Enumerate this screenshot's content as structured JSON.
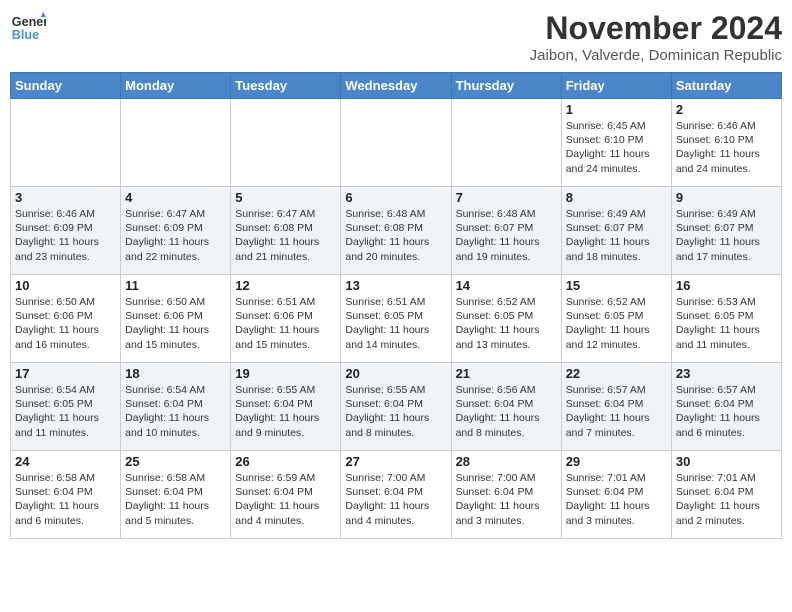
{
  "header": {
    "logo_line1": "General",
    "logo_line2": "Blue",
    "month": "November 2024",
    "location": "Jaibon, Valverde, Dominican Republic"
  },
  "weekdays": [
    "Sunday",
    "Monday",
    "Tuesday",
    "Wednesday",
    "Thursday",
    "Friday",
    "Saturday"
  ],
  "weeks": [
    [
      {
        "day": "",
        "info": ""
      },
      {
        "day": "",
        "info": ""
      },
      {
        "day": "",
        "info": ""
      },
      {
        "day": "",
        "info": ""
      },
      {
        "day": "",
        "info": ""
      },
      {
        "day": "1",
        "info": "Sunrise: 6:45 AM\nSunset: 6:10 PM\nDaylight: 11 hours and 24 minutes."
      },
      {
        "day": "2",
        "info": "Sunrise: 6:46 AM\nSunset: 6:10 PM\nDaylight: 11 hours and 24 minutes."
      }
    ],
    [
      {
        "day": "3",
        "info": "Sunrise: 6:46 AM\nSunset: 6:09 PM\nDaylight: 11 hours and 23 minutes."
      },
      {
        "day": "4",
        "info": "Sunrise: 6:47 AM\nSunset: 6:09 PM\nDaylight: 11 hours and 22 minutes."
      },
      {
        "day": "5",
        "info": "Sunrise: 6:47 AM\nSunset: 6:08 PM\nDaylight: 11 hours and 21 minutes."
      },
      {
        "day": "6",
        "info": "Sunrise: 6:48 AM\nSunset: 6:08 PM\nDaylight: 11 hours and 20 minutes."
      },
      {
        "day": "7",
        "info": "Sunrise: 6:48 AM\nSunset: 6:07 PM\nDaylight: 11 hours and 19 minutes."
      },
      {
        "day": "8",
        "info": "Sunrise: 6:49 AM\nSunset: 6:07 PM\nDaylight: 11 hours and 18 minutes."
      },
      {
        "day": "9",
        "info": "Sunrise: 6:49 AM\nSunset: 6:07 PM\nDaylight: 11 hours and 17 minutes."
      }
    ],
    [
      {
        "day": "10",
        "info": "Sunrise: 6:50 AM\nSunset: 6:06 PM\nDaylight: 11 hours and 16 minutes."
      },
      {
        "day": "11",
        "info": "Sunrise: 6:50 AM\nSunset: 6:06 PM\nDaylight: 11 hours and 15 minutes."
      },
      {
        "day": "12",
        "info": "Sunrise: 6:51 AM\nSunset: 6:06 PM\nDaylight: 11 hours and 15 minutes."
      },
      {
        "day": "13",
        "info": "Sunrise: 6:51 AM\nSunset: 6:05 PM\nDaylight: 11 hours and 14 minutes."
      },
      {
        "day": "14",
        "info": "Sunrise: 6:52 AM\nSunset: 6:05 PM\nDaylight: 11 hours and 13 minutes."
      },
      {
        "day": "15",
        "info": "Sunrise: 6:52 AM\nSunset: 6:05 PM\nDaylight: 11 hours and 12 minutes."
      },
      {
        "day": "16",
        "info": "Sunrise: 6:53 AM\nSunset: 6:05 PM\nDaylight: 11 hours and 11 minutes."
      }
    ],
    [
      {
        "day": "17",
        "info": "Sunrise: 6:54 AM\nSunset: 6:05 PM\nDaylight: 11 hours and 11 minutes."
      },
      {
        "day": "18",
        "info": "Sunrise: 6:54 AM\nSunset: 6:04 PM\nDaylight: 11 hours and 10 minutes."
      },
      {
        "day": "19",
        "info": "Sunrise: 6:55 AM\nSunset: 6:04 PM\nDaylight: 11 hours and 9 minutes."
      },
      {
        "day": "20",
        "info": "Sunrise: 6:55 AM\nSunset: 6:04 PM\nDaylight: 11 hours and 8 minutes."
      },
      {
        "day": "21",
        "info": "Sunrise: 6:56 AM\nSunset: 6:04 PM\nDaylight: 11 hours and 8 minutes."
      },
      {
        "day": "22",
        "info": "Sunrise: 6:57 AM\nSunset: 6:04 PM\nDaylight: 11 hours and 7 minutes."
      },
      {
        "day": "23",
        "info": "Sunrise: 6:57 AM\nSunset: 6:04 PM\nDaylight: 11 hours and 6 minutes."
      }
    ],
    [
      {
        "day": "24",
        "info": "Sunrise: 6:58 AM\nSunset: 6:04 PM\nDaylight: 11 hours and 6 minutes."
      },
      {
        "day": "25",
        "info": "Sunrise: 6:58 AM\nSunset: 6:04 PM\nDaylight: 11 hours and 5 minutes."
      },
      {
        "day": "26",
        "info": "Sunrise: 6:59 AM\nSunset: 6:04 PM\nDaylight: 11 hours and 4 minutes."
      },
      {
        "day": "27",
        "info": "Sunrise: 7:00 AM\nSunset: 6:04 PM\nDaylight: 11 hours and 4 minutes."
      },
      {
        "day": "28",
        "info": "Sunrise: 7:00 AM\nSunset: 6:04 PM\nDaylight: 11 hours and 3 minutes."
      },
      {
        "day": "29",
        "info": "Sunrise: 7:01 AM\nSunset: 6:04 PM\nDaylight: 11 hours and 3 minutes."
      },
      {
        "day": "30",
        "info": "Sunrise: 7:01 AM\nSunset: 6:04 PM\nDaylight: 11 hours and 2 minutes."
      }
    ]
  ]
}
